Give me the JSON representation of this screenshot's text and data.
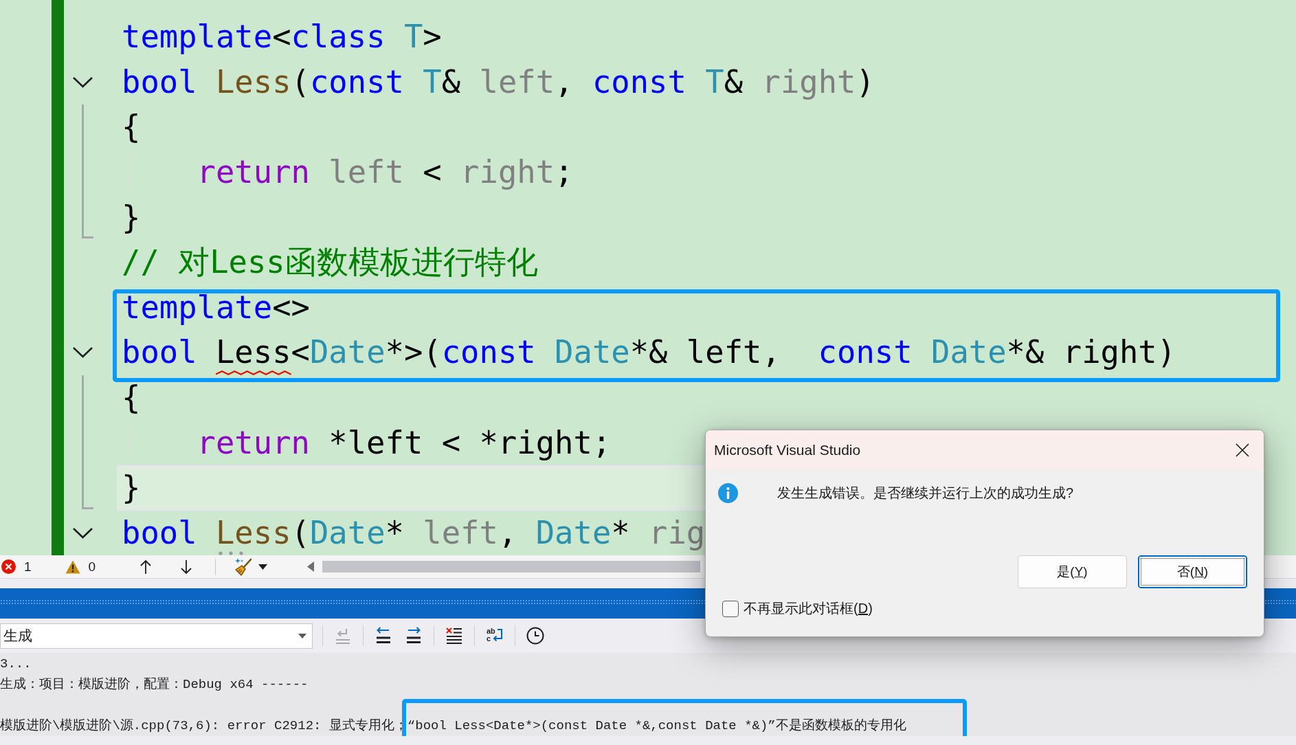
{
  "editor": {
    "code_lines": [
      {
        "tokens": [
          {
            "kind": "keyword",
            "text": "template"
          },
          {
            "kind": "plain",
            "text": "<"
          },
          {
            "kind": "keyword",
            "text": "class "
          },
          {
            "kind": "type",
            "text": "T"
          },
          {
            "kind": "plain",
            "text": ">"
          }
        ],
        "framed": false,
        "current": false
      },
      {
        "tokens": [
          {
            "kind": "keyword",
            "text": "bool "
          },
          {
            "kind": "function",
            "text": "Less"
          },
          {
            "kind": "plain",
            "text": "("
          },
          {
            "kind": "keyword",
            "text": "const "
          },
          {
            "kind": "type",
            "text": "T"
          },
          {
            "kind": "plain",
            "text": "& "
          },
          {
            "kind": "parameter",
            "text": "left"
          },
          {
            "kind": "plain",
            "text": ", "
          },
          {
            "kind": "keyword",
            "text": "const "
          },
          {
            "kind": "type",
            "text": "T"
          },
          {
            "kind": "plain",
            "text": "& "
          },
          {
            "kind": "parameter",
            "text": "right"
          },
          {
            "kind": "plain",
            "text": ")"
          }
        ],
        "expanded": true,
        "framed": false,
        "current": false,
        "children": [
          {
            "tokens": [
              {
                "kind": "plain",
                "text": "{"
              }
            ],
            "current": false
          },
          {
            "tokens": [
              {
                "kind": "control",
                "text": "return "
              },
              {
                "kind": "parameter",
                "text": "left"
              },
              {
                "kind": "plain",
                "text": " < "
              },
              {
                "kind": "parameter",
                "text": "right"
              },
              {
                "kind": "plain",
                "text": ";"
              }
            ],
            "indented": true,
            "current": false
          },
          {
            "tokens": [
              {
                "kind": "plain",
                "text": "}"
              }
            ],
            "current": false
          }
        ]
      },
      {
        "tokens": [
          {
            "kind": "comment",
            "text": "// 对Less函数模板进行特化"
          }
        ],
        "framed": false,
        "current": false
      },
      {
        "tokens": [
          {
            "kind": "keyword",
            "text": "template"
          },
          {
            "kind": "plain",
            "text": "<>"
          }
        ],
        "framed": true,
        "current": false
      },
      {
        "tokens": [
          {
            "kind": "keyword",
            "text": "bool "
          },
          {
            "kind": "plain",
            "text": "Less",
            "error_underline": true
          },
          {
            "kind": "plain",
            "text": "<"
          },
          {
            "kind": "type",
            "text": "Date"
          },
          {
            "kind": "plain",
            "text": "*>("
          },
          {
            "kind": "keyword",
            "text": "const "
          },
          {
            "kind": "type",
            "text": "Date"
          },
          {
            "kind": "plain",
            "text": "*& left,  "
          },
          {
            "kind": "keyword",
            "text": "const "
          },
          {
            "kind": "type",
            "text": "Date"
          },
          {
            "kind": "plain",
            "text": "*& right)"
          }
        ],
        "expanded": true,
        "framed": true,
        "current": false,
        "children": [
          {
            "tokens": [
              {
                "kind": "plain",
                "text": "{"
              }
            ],
            "current": false
          },
          {
            "tokens": [
              {
                "kind": "control",
                "text": "return "
              },
              {
                "kind": "plain",
                "text": "*left < *right;"
              }
            ],
            "indented": true,
            "current": false
          },
          {
            "tokens": [
              {
                "kind": "plain",
                "text": "}"
              }
            ],
            "current": true
          }
        ]
      },
      {
        "tokens": [
          {
            "kind": "keyword",
            "text": "bool "
          },
          {
            "kind": "function",
            "text": "Less",
            "suggestion_dots": true
          },
          {
            "kind": "plain",
            "text": "("
          },
          {
            "kind": "type",
            "text": "Date"
          },
          {
            "kind": "plain",
            "text": "* "
          },
          {
            "kind": "parameter",
            "text": "left"
          },
          {
            "kind": "plain",
            "text": ", "
          },
          {
            "kind": "type",
            "text": "Date"
          },
          {
            "kind": "plain",
            "text": "* "
          },
          {
            "kind": "parameter",
            "text": "rig"
          }
        ],
        "expanded": true,
        "framed": false,
        "current": false
      }
    ]
  },
  "editor_status_bar": {
    "errors": "1",
    "warnings": "0"
  },
  "output_panel": {
    "source": "生成",
    "toolbar_groups": [
      [
        {
          "kind": "go-to-source",
          "disabled": true
        }
      ],
      [
        {
          "kind": "previous-message",
          "disabled": false
        },
        {
          "kind": "next-message",
          "disabled": false
        }
      ],
      [
        {
          "kind": "clear-all",
          "disabled": false
        }
      ],
      [
        {
          "kind": "word-wrap",
          "disabled": false,
          "letters": "abc"
        }
      ],
      [
        {
          "kind": "history",
          "disabled": false
        }
      ]
    ],
    "line_groups": [
      [
        {
          "text": "3..."
        },
        {
          "text": "生成：项目：模版进阶，配置：Debug x64 ------"
        }
      ],
      [
        {
          "text": "模版进阶\\模版进阶\\源.cpp(73,6): error C2912: 显式专用化；",
          "framed_text": "“bool Less<Date*>(const Date *&,const Date *&)”不是函数模板的专用化"
        }
      ]
    ]
  },
  "dialog": {
    "title": "Microsoft Visual Studio",
    "message": "发生生成错误。是否继续并运行上次的成功生成?",
    "buttons": [
      {
        "label": "是(Y)",
        "focused": false
      },
      {
        "label": "否(N)",
        "focused": true
      }
    ],
    "checkbox": {
      "label": "不再显示此对话框(D)",
      "checked": false
    }
  }
}
